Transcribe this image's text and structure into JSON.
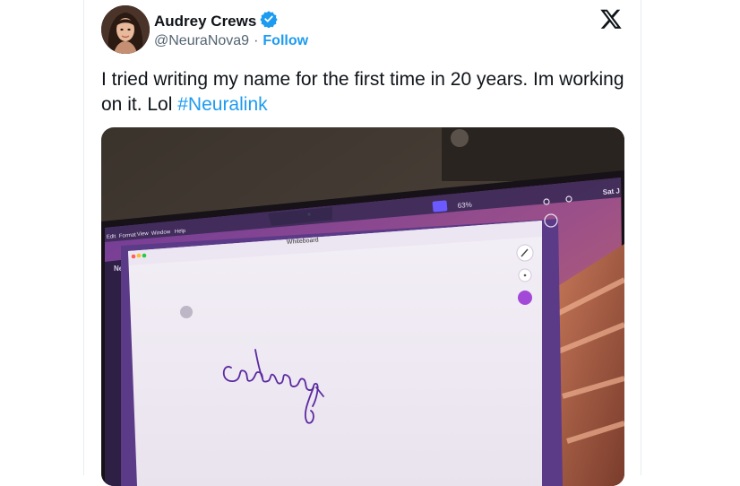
{
  "author": {
    "name": "Audrey Crews",
    "handle": "@NeuraNova9",
    "separator": "·",
    "follow_label": "Follow",
    "verified_color": "#1d9bf0"
  },
  "tweet": {
    "text": "I tried writing my name for the first time in 20 years. Im working on it. Lol ",
    "hashtag": "#Neuralink"
  },
  "photo": {
    "menu_items": [
      "Edit",
      "Format",
      "View",
      "Window",
      "Help"
    ],
    "status": {
      "battery": "63%",
      "date": "Sat J"
    },
    "window_title": "Whiteboard",
    "sidebar_title": "Neura",
    "handwriting": "Audrey",
    "brush_color": "#a249d8"
  }
}
